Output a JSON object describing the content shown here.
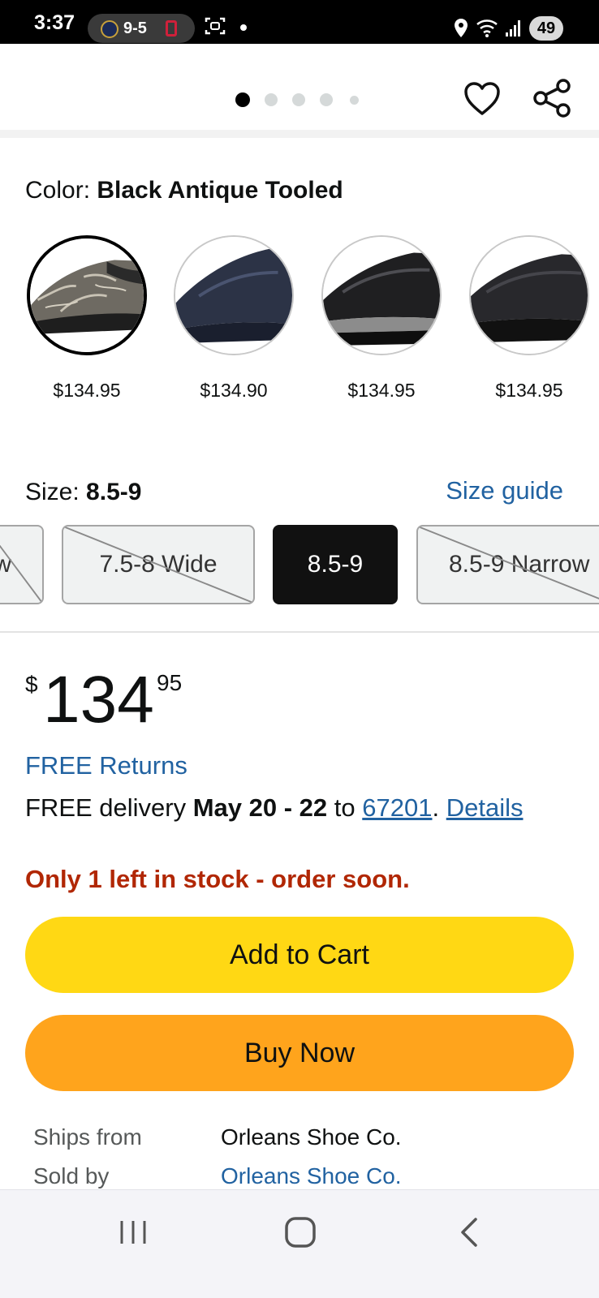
{
  "status_bar": {
    "time": "3:37",
    "score": "9-5",
    "battery": "49"
  },
  "image_carousel": {
    "page_count": 5,
    "current_page": 1
  },
  "color": {
    "label": "Color:",
    "selected": "Black Antique Tooled",
    "options": [
      {
        "price": "$134.95",
        "shoe_color": "#6e6a62",
        "selected": true
      },
      {
        "price": "$134.90",
        "shoe_color": "#2c3346",
        "selected": false
      },
      {
        "price": "$134.95",
        "shoe_color": "#1f1f21",
        "selected": false
      },
      {
        "price": "$134.95",
        "shoe_color": "#28282c",
        "selected": false
      }
    ]
  },
  "size": {
    "label": "Size:",
    "selected": "8.5-9",
    "guide_label": "Size guide",
    "options": [
      {
        "label": "w",
        "available": false
      },
      {
        "label": "7.5-8 Wide",
        "available": false
      },
      {
        "label": "8.5-9",
        "available": true,
        "selected": true
      },
      {
        "label": "8.5-9 Narrow",
        "available": false
      }
    ]
  },
  "price": {
    "symbol": "$",
    "whole": "134",
    "fraction": "95"
  },
  "free_returns": "FREE Returns",
  "delivery": {
    "prefix": "FREE delivery ",
    "dates": "May 20 - 22",
    "to_text": " to ",
    "zip": "67201",
    "separator": ". ",
    "details_label": "Details"
  },
  "stock_message": "Only 1 left in stock - order soon.",
  "buttons": {
    "add_to_cart": "Add to Cart",
    "buy_now": "Buy Now"
  },
  "seller_info": {
    "ships_from_label": "Ships from",
    "ships_from_value": "Orleans Shoe Co.",
    "sold_by_label": "Sold by",
    "sold_by_value": "Orleans Shoe Co."
  },
  "colors": {
    "link": "#2162a1",
    "stock_warning": "#b12704",
    "add_to_cart": "#ffd814",
    "buy_now": "#ffa41c"
  },
  "icons": [
    "heart-icon",
    "share-icon",
    "recents-icon",
    "home-icon",
    "back-icon"
  ]
}
